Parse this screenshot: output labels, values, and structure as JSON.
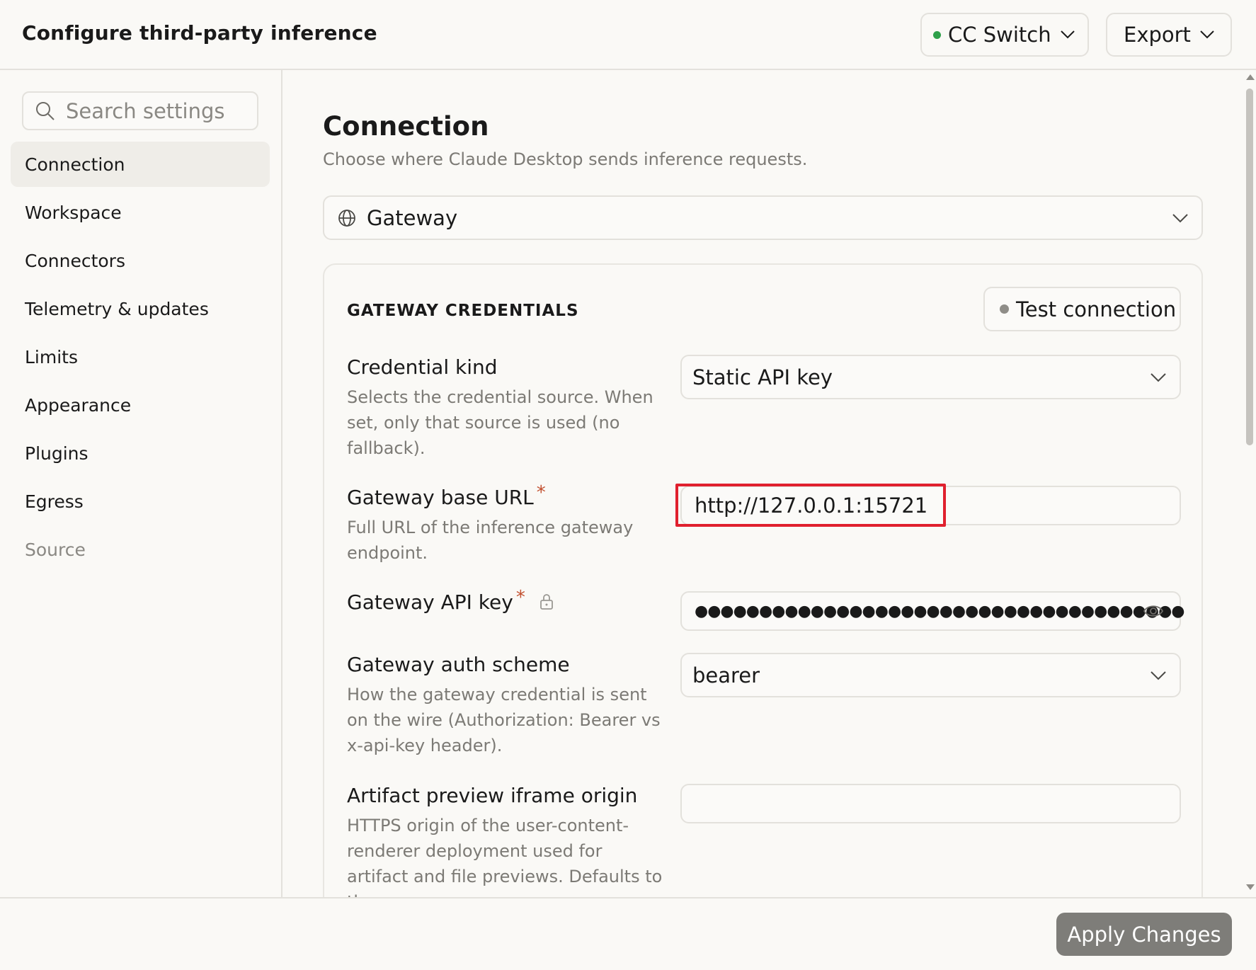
{
  "header": {
    "title": "Configure third-party inference",
    "profile_button": {
      "label": "CC Switch",
      "status_color": "#2fa04a"
    },
    "export_button": {
      "label": "Export"
    }
  },
  "sidebar": {
    "search": {
      "placeholder": "Search settings",
      "value": ""
    },
    "items": [
      {
        "label": "Connection",
        "active": true
      },
      {
        "label": "Workspace",
        "active": false
      },
      {
        "label": "Connectors",
        "active": false
      },
      {
        "label": "Telemetry & updates",
        "active": false
      },
      {
        "label": "Limits",
        "active": false
      },
      {
        "label": "Appearance",
        "active": false
      },
      {
        "label": "Plugins",
        "active": false
      },
      {
        "label": "Egress",
        "active": false
      },
      {
        "label": "Source",
        "active": false
      }
    ]
  },
  "main": {
    "title": "Connection",
    "subtitle": "Choose where Claude Desktop sends inference requests.",
    "mode_select": {
      "value": "Gateway",
      "icon": "globe-icon"
    },
    "card": {
      "heading": "GATEWAY CREDENTIALS",
      "test_button": {
        "label": "Test connection",
        "status_color": "#8f8d88"
      },
      "fields": {
        "credential_kind": {
          "label": "Credential kind",
          "description": "Selects the credential source. When set, only that source is used (no fallback).",
          "value": "Static API key"
        },
        "base_url": {
          "label": "Gateway base URL",
          "required_mark": "*",
          "description": "Full URL of the inference gateway endpoint.",
          "value": "http://127.0.0.1:15721"
        },
        "api_key": {
          "label": "Gateway API key",
          "required_mark": "*",
          "masked_value": "●●●●●●●●●●●●●●●●●●●●●●●●●●●●●●●●●●●●●●"
        },
        "auth_scheme": {
          "label": "Gateway auth scheme",
          "description": "How the gateway credential is sent on the wire (Authorization: Bearer vs x-api-key header).",
          "value": "bearer"
        },
        "artifact_origin": {
          "label": "Artifact preview iframe origin",
          "description": "HTTPS origin of the user-content-renderer deployment used for artifact and file previews. Defaults to the",
          "value": ""
        }
      }
    }
  },
  "footer": {
    "apply_button": {
      "label": "Apply Changes"
    }
  },
  "colors": {
    "background": "#faf9f6",
    "border": "#e3e1dc",
    "muted_text": "#7c7a75",
    "required": "#c2502f",
    "highlight": "#e0202e",
    "apply_button": "#7e7d79"
  }
}
